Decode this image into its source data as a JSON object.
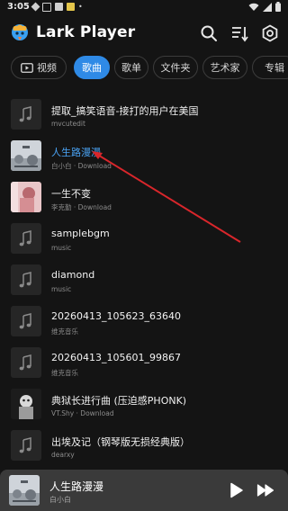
{
  "status_bar": {
    "time": "3:05"
  },
  "header": {
    "title": "Lark Player"
  },
  "tabs": [
    {
      "label": "视频",
      "icon": "video-icon"
    },
    {
      "label": "歌曲",
      "active": true
    },
    {
      "label": "歌单"
    },
    {
      "label": "文件夹"
    },
    {
      "label": "艺术家"
    },
    {
      "label": "专辑"
    }
  ],
  "songs": [
    {
      "title": "提取_搞笑语音-接打的用户在美国",
      "subtitle": "mvcutedit",
      "download": false,
      "thumb": "note"
    },
    {
      "title": "人生路漫漫",
      "subtitle": "白小白 · Download",
      "download": true,
      "thumb": "art-gray",
      "playing": true
    },
    {
      "title": "一生不变",
      "subtitle": "李克勤 · Download",
      "download": true,
      "thumb": "art-pink"
    },
    {
      "title": "samplebgm",
      "subtitle": "music",
      "download": false,
      "thumb": "note"
    },
    {
      "title": "diamond",
      "subtitle": "music",
      "download": false,
      "thumb": "note"
    },
    {
      "title": "20260413_105623_63640",
      "subtitle": "维克音乐",
      "download": false,
      "thumb": "note"
    },
    {
      "title": "20260413_105601_99867",
      "subtitle": "维克音乐",
      "download": false,
      "thumb": "note"
    },
    {
      "title": "典狱长进行曲 (压迫感PHONK)",
      "subtitle": "VT.Shy · Download",
      "download": true,
      "thumb": "art-dark"
    },
    {
      "title": "出埃及记（钢琴版无损经典版）",
      "subtitle": "dearxy",
      "download": false,
      "thumb": "note"
    }
  ],
  "mini_player": {
    "title": "人生路漫漫",
    "artist": "白小白"
  },
  "colors": {
    "background": "#141414",
    "accent": "#2f8ae6",
    "playing_text": "#4aa3f4",
    "annotation_arrow": "#d9262b",
    "mini_player_bg": "#3a3a3a"
  }
}
